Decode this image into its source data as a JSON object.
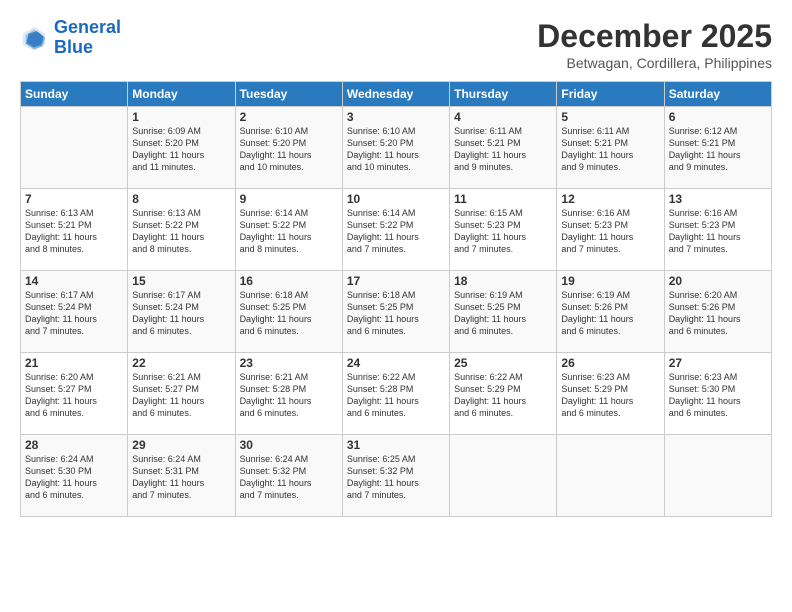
{
  "logo": {
    "line1": "General",
    "line2": "Blue"
  },
  "title": "December 2025",
  "subtitle": "Betwagan, Cordillera, Philippines",
  "days_header": [
    "Sunday",
    "Monday",
    "Tuesday",
    "Wednesday",
    "Thursday",
    "Friday",
    "Saturday"
  ],
  "weeks": [
    [
      {
        "day": "",
        "sunrise": "",
        "sunset": "",
        "daylight": ""
      },
      {
        "day": "1",
        "sunrise": "6:09 AM",
        "sunset": "5:20 PM",
        "daylight": "11 hours and 11 minutes."
      },
      {
        "day": "2",
        "sunrise": "6:10 AM",
        "sunset": "5:20 PM",
        "daylight": "11 hours and 10 minutes."
      },
      {
        "day": "3",
        "sunrise": "6:10 AM",
        "sunset": "5:20 PM",
        "daylight": "11 hours and 10 minutes."
      },
      {
        "day": "4",
        "sunrise": "6:11 AM",
        "sunset": "5:21 PM",
        "daylight": "11 hours and 9 minutes."
      },
      {
        "day": "5",
        "sunrise": "6:11 AM",
        "sunset": "5:21 PM",
        "daylight": "11 hours and 9 minutes."
      },
      {
        "day": "6",
        "sunrise": "6:12 AM",
        "sunset": "5:21 PM",
        "daylight": "11 hours and 9 minutes."
      }
    ],
    [
      {
        "day": "7",
        "sunrise": "6:13 AM",
        "sunset": "5:21 PM",
        "daylight": "11 hours and 8 minutes."
      },
      {
        "day": "8",
        "sunrise": "6:13 AM",
        "sunset": "5:22 PM",
        "daylight": "11 hours and 8 minutes."
      },
      {
        "day": "9",
        "sunrise": "6:14 AM",
        "sunset": "5:22 PM",
        "daylight": "11 hours and 8 minutes."
      },
      {
        "day": "10",
        "sunrise": "6:14 AM",
        "sunset": "5:22 PM",
        "daylight": "11 hours and 7 minutes."
      },
      {
        "day": "11",
        "sunrise": "6:15 AM",
        "sunset": "5:23 PM",
        "daylight": "11 hours and 7 minutes."
      },
      {
        "day": "12",
        "sunrise": "6:16 AM",
        "sunset": "5:23 PM",
        "daylight": "11 hours and 7 minutes."
      },
      {
        "day": "13",
        "sunrise": "6:16 AM",
        "sunset": "5:23 PM",
        "daylight": "11 hours and 7 minutes."
      }
    ],
    [
      {
        "day": "14",
        "sunrise": "6:17 AM",
        "sunset": "5:24 PM",
        "daylight": "11 hours and 7 minutes."
      },
      {
        "day": "15",
        "sunrise": "6:17 AM",
        "sunset": "5:24 PM",
        "daylight": "11 hours and 6 minutes."
      },
      {
        "day": "16",
        "sunrise": "6:18 AM",
        "sunset": "5:25 PM",
        "daylight": "11 hours and 6 minutes."
      },
      {
        "day": "17",
        "sunrise": "6:18 AM",
        "sunset": "5:25 PM",
        "daylight": "11 hours and 6 minutes."
      },
      {
        "day": "18",
        "sunrise": "6:19 AM",
        "sunset": "5:25 PM",
        "daylight": "11 hours and 6 minutes."
      },
      {
        "day": "19",
        "sunrise": "6:19 AM",
        "sunset": "5:26 PM",
        "daylight": "11 hours and 6 minutes."
      },
      {
        "day": "20",
        "sunrise": "6:20 AM",
        "sunset": "5:26 PM",
        "daylight": "11 hours and 6 minutes."
      }
    ],
    [
      {
        "day": "21",
        "sunrise": "6:20 AM",
        "sunset": "5:27 PM",
        "daylight": "11 hours and 6 minutes."
      },
      {
        "day": "22",
        "sunrise": "6:21 AM",
        "sunset": "5:27 PM",
        "daylight": "11 hours and 6 minutes."
      },
      {
        "day": "23",
        "sunrise": "6:21 AM",
        "sunset": "5:28 PM",
        "daylight": "11 hours and 6 minutes."
      },
      {
        "day": "24",
        "sunrise": "6:22 AM",
        "sunset": "5:28 PM",
        "daylight": "11 hours and 6 minutes."
      },
      {
        "day": "25",
        "sunrise": "6:22 AM",
        "sunset": "5:29 PM",
        "daylight": "11 hours and 6 minutes."
      },
      {
        "day": "26",
        "sunrise": "6:23 AM",
        "sunset": "5:29 PM",
        "daylight": "11 hours and 6 minutes."
      },
      {
        "day": "27",
        "sunrise": "6:23 AM",
        "sunset": "5:30 PM",
        "daylight": "11 hours and 6 minutes."
      }
    ],
    [
      {
        "day": "28",
        "sunrise": "6:24 AM",
        "sunset": "5:30 PM",
        "daylight": "11 hours and 6 minutes."
      },
      {
        "day": "29",
        "sunrise": "6:24 AM",
        "sunset": "5:31 PM",
        "daylight": "11 hours and 7 minutes."
      },
      {
        "day": "30",
        "sunrise": "6:24 AM",
        "sunset": "5:32 PM",
        "daylight": "11 hours and 7 minutes."
      },
      {
        "day": "31",
        "sunrise": "6:25 AM",
        "sunset": "5:32 PM",
        "daylight": "11 hours and 7 minutes."
      },
      {
        "day": "",
        "sunrise": "",
        "sunset": "",
        "daylight": ""
      },
      {
        "day": "",
        "sunrise": "",
        "sunset": "",
        "daylight": ""
      },
      {
        "day": "",
        "sunrise": "",
        "sunset": "",
        "daylight": ""
      }
    ]
  ]
}
